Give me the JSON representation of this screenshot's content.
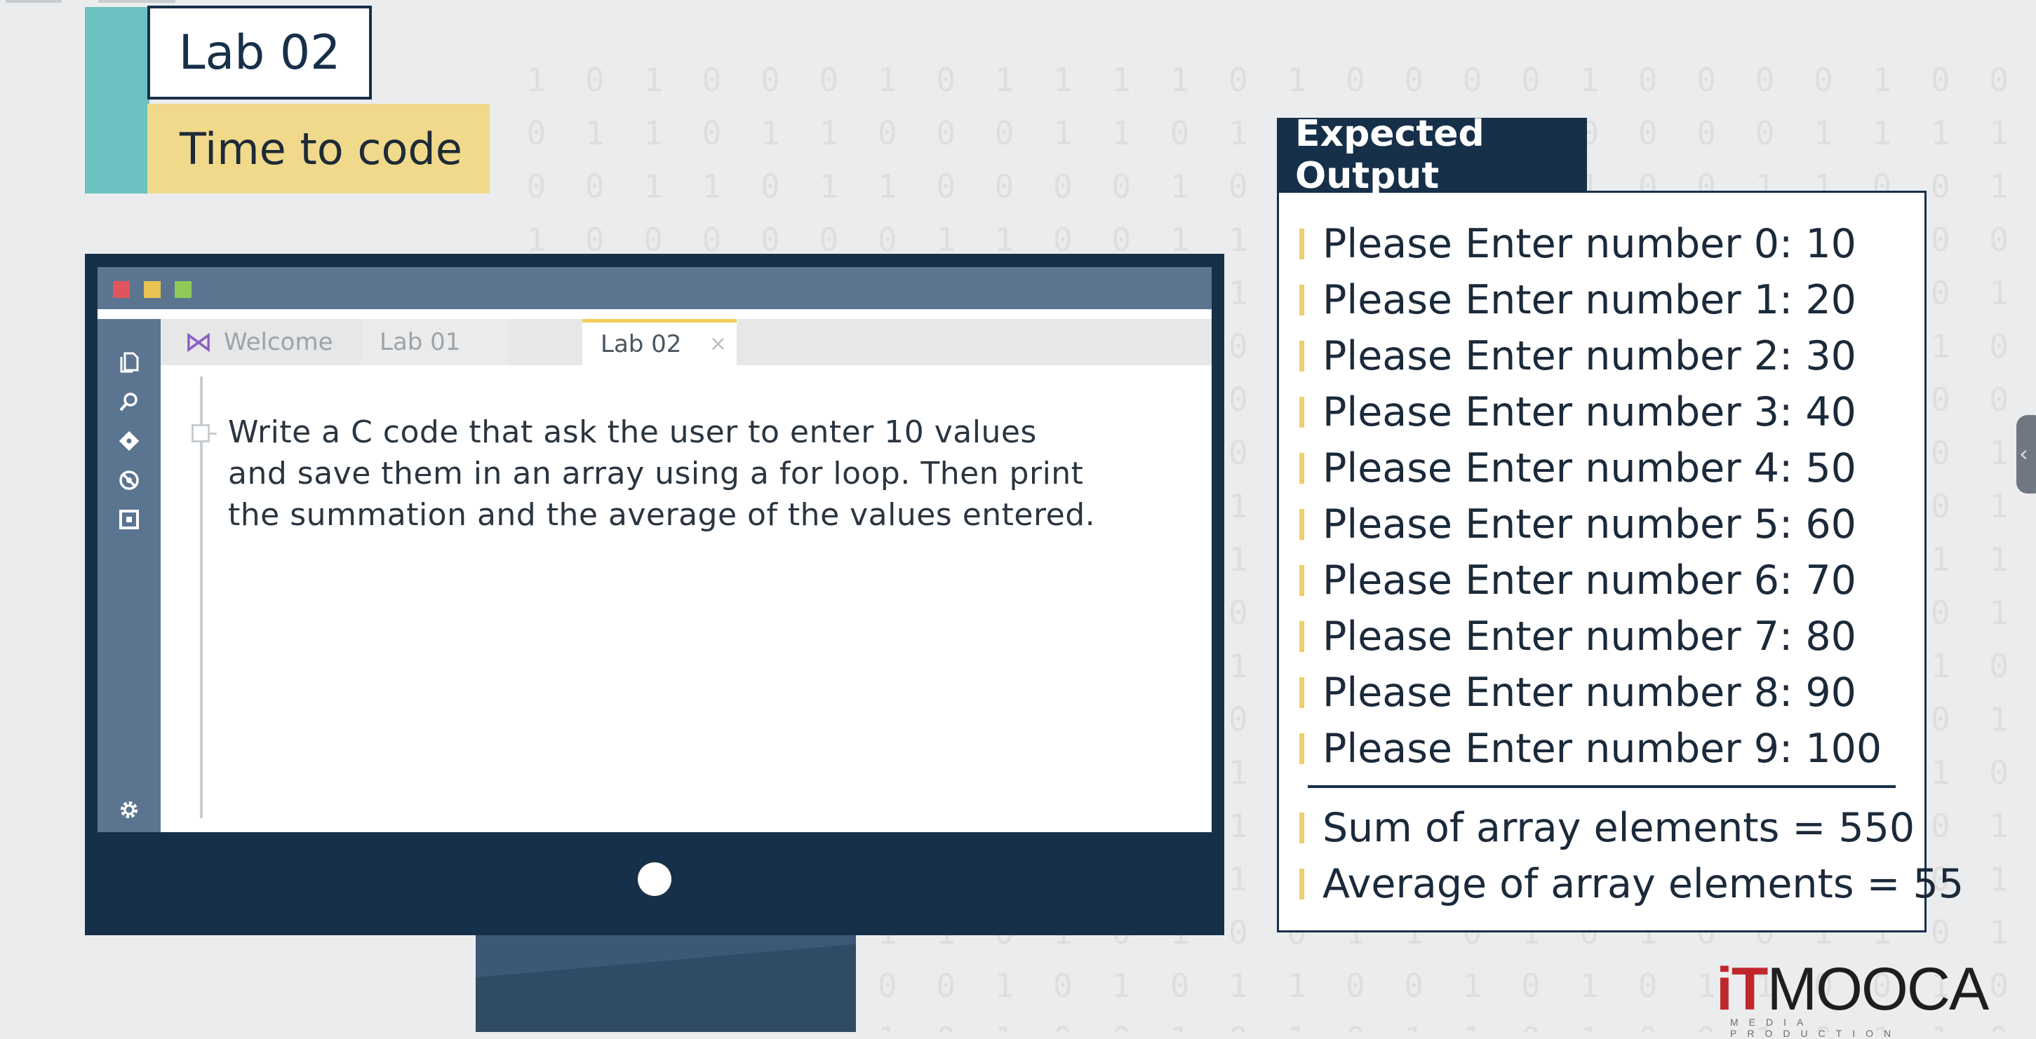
{
  "header": {
    "lab_title": "Lab 02",
    "subtitle": "Time to code"
  },
  "editor": {
    "tabs": [
      {
        "label": "Welcome",
        "icon": "visual-studio-icon",
        "active": false
      },
      {
        "label": "Lab 01",
        "active": false
      },
      {
        "label": "Lab 02",
        "active": true,
        "close_symbol": "×"
      }
    ],
    "sidebar_icons": [
      "files-icon",
      "search-icon",
      "git-icon",
      "debug-icon",
      "extensions-icon",
      "gear-icon"
    ],
    "instructions": [
      "Write a C code that ask the user to enter 10 values",
      "and save them in an array using a for loop. Then print",
      "the summation and the average of the values entered."
    ]
  },
  "expected_output": {
    "title": "Expected Output",
    "prompt_lines": [
      "Please Enter number 0:  10",
      "Please Enter number 1:  20",
      "Please Enter number 2:  30",
      "Please Enter number 3:  40",
      "Please Enter number 4:  50",
      "Please Enter number 5:  60",
      "Please Enter number 6:  70",
      "Please Enter number 7:  80",
      "Please Enter number 8:  90",
      "Please Enter number 9:  100"
    ],
    "summary_lines": [
      "Sum of array elements = 550",
      "Average of array elements = 55"
    ]
  },
  "logo": {
    "mark": "iT",
    "name": "MOOCA",
    "tagline": "MEDIA PRODUCTION"
  },
  "colors": {
    "navy": "#17304a",
    "teal": "#6bc1bf",
    "gold": "#f0d98b",
    "editor_chrome": "#5b7591",
    "brand_red": "#c0272d"
  }
}
